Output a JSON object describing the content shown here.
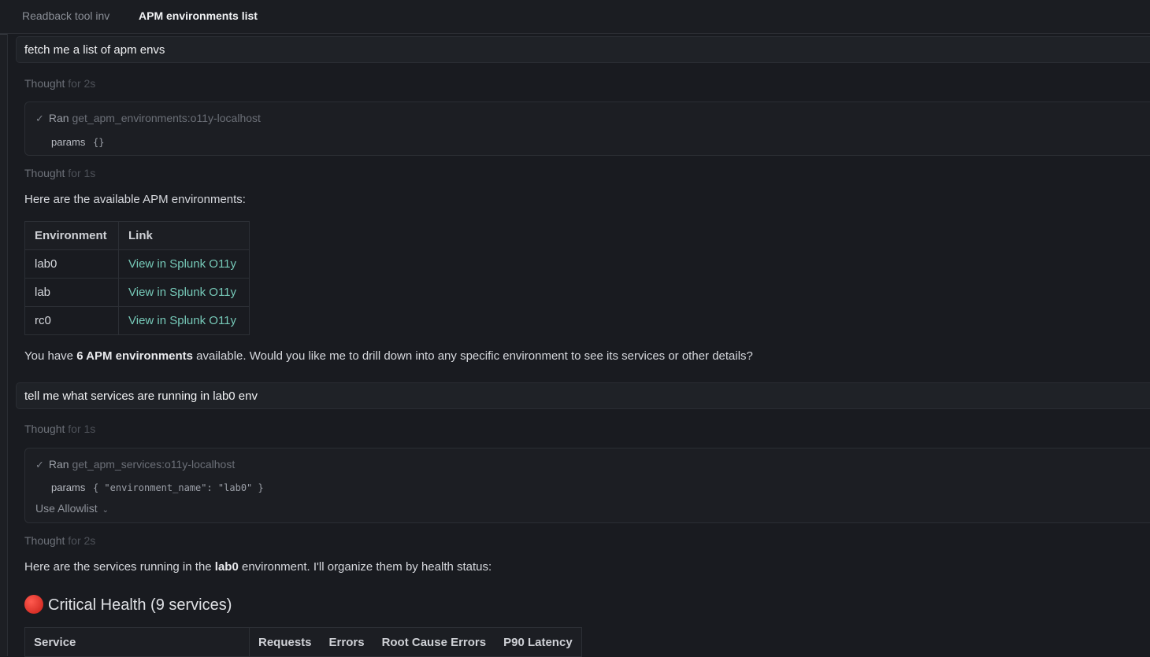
{
  "tabs": [
    {
      "label": "Readback tool inv"
    },
    {
      "label": "APM environments list"
    }
  ],
  "conversation": {
    "msg1": "fetch me a list of apm envs",
    "thought1": {
      "label": "Thought",
      "duration": "for 2s"
    },
    "tool1": {
      "check": "✓",
      "ran": "Ran",
      "fn": "get_apm_environments:o11y-localhost",
      "params_label": "params",
      "params_value": "{}"
    },
    "thought2": {
      "label": "Thought",
      "duration": "for 1s"
    },
    "intro1": "Here are the available APM environments:",
    "env_table": {
      "headers": [
        "Environment",
        "Link"
      ],
      "rows": [
        {
          "env": "lab0",
          "link": "View in Splunk O11y"
        },
        {
          "env": "lab",
          "link": "View in Splunk O11y"
        },
        {
          "env": "rc0",
          "link": "View in Splunk O11y"
        }
      ]
    },
    "summary": {
      "pre": "You have ",
      "bold": "6 APM environments",
      "post": " available. Would you like me to drill down into any specific environment to see its services or other details?"
    },
    "msg2": "tell me what services are running in lab0 env",
    "thought3": {
      "label": "Thought",
      "duration": "for 1s"
    },
    "tool2": {
      "check": "✓",
      "ran": "Ran",
      "fn": "get_apm_services:o11y-localhost",
      "params_label": "params",
      "params_value": "{ \"environment_name\": \"lab0\" }",
      "allowlist": "Use Allowlist"
    },
    "thought4": {
      "label": "Thought",
      "duration": "for 2s"
    },
    "intro2": {
      "pre": "Here are the services running in the ",
      "bold": "lab0",
      "post": " environment. I'll organize them by health status:"
    },
    "critical": {
      "title": "Critical Health (9 services)"
    },
    "svc_table": {
      "headers": [
        "Service",
        "Requests",
        "Errors",
        "Root Cause Errors",
        "P90 Latency"
      ]
    }
  }
}
